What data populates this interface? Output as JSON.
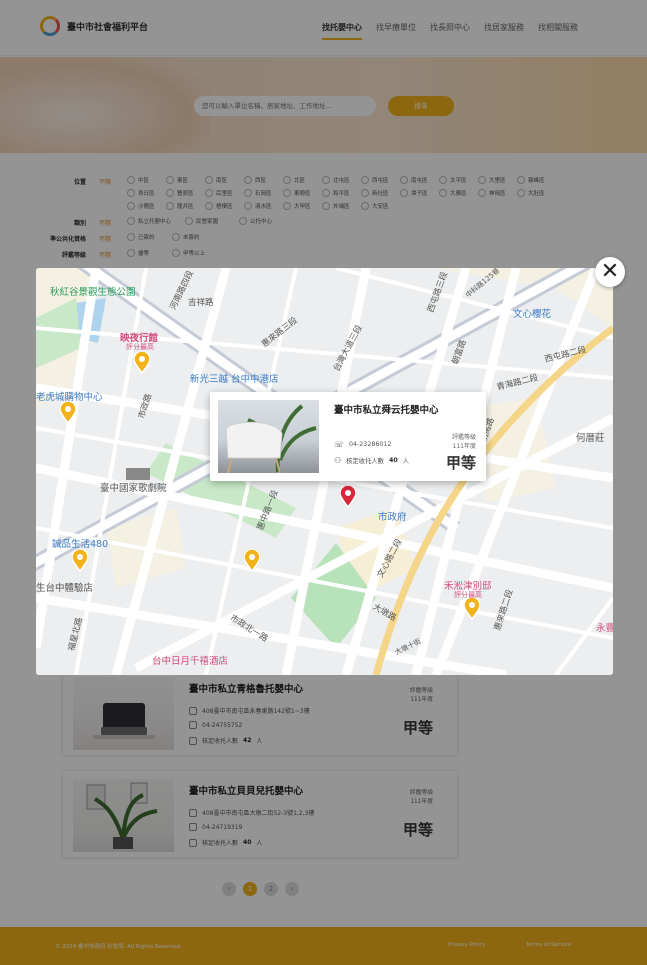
{
  "header": {
    "brand": "臺中市社會福利平台",
    "nav": [
      "找托嬰中心",
      "找早療單位",
      "找長照中心",
      "找居家服務",
      "找相關服務"
    ]
  },
  "search": {
    "placeholder": "您可以輸入單位名稱、居家地址、工作地址...",
    "button": "搜尋"
  },
  "filters": {
    "all_label": "不限",
    "location": {
      "label": "位置",
      "options": [
        "中區",
        "東區",
        "南區",
        "西區",
        "北區",
        "北屯區",
        "西屯區",
        "南屯區",
        "太平區",
        "大里區",
        "霧峰區",
        "烏日區",
        "豐原區",
        "后里區",
        "石岡區",
        "東勢區",
        "和平區",
        "新社區",
        "潭子區",
        "大雅區",
        "神岡區",
        "大肚區",
        "沙鹿區",
        "龍井區",
        "梧棲區",
        "清水區",
        "大甲區",
        "外埔區",
        "大安區"
      ]
    },
    "type": {
      "label": "類別",
      "options": [
        "私立托嬰中心",
        "民營家園",
        "公托中心"
      ]
    },
    "public": {
      "label": "準公共化資格",
      "options": [
        "已簽約",
        "未簽約"
      ]
    },
    "rating": {
      "label": "評鑑等級",
      "options": [
        "優等",
        "甲等以上"
      ]
    }
  },
  "map": {
    "labels": {
      "park": "秋紅谷景觀生態公園",
      "cinema": "映夜行館",
      "cinema_sub": "評分最高",
      "mall": "新光三越 台中中港店",
      "mall2": "老虎城購物中心",
      "opera": "臺中國家歌劇院",
      "eslite": "誠品生活480",
      "gym": "生台中體驗店",
      "hotel": "台中日月千禧酒店",
      "villa": "禾淞津別邸",
      "villa_sub": "評分最高",
      "cityhall": "市政府",
      "wenxin": "文心櫻花",
      "heping": "何厝莊",
      "yong": "永豐",
      "road_hui": "惠來路三段",
      "road_shizheng": "市政北一路",
      "road_wenxin": "文心路二段",
      "road_daya": "大墩路",
      "road_qinghai": "青海路二段",
      "road_xitun": "西屯路二段",
      "road_chaoma": "朝馬路",
      "road_chaofu": "朝富路",
      "road_jixiang": "吉祥路",
      "road_henan": "河南路四段",
      "road_xitun3": "西屯路三段",
      "road_taizhonggang": "台灣大道三段",
      "road_huizhong": "惠中路一段",
      "road_fuxing": "福星北路",
      "road_dadun10": "大墩十街",
      "road_huilai1": "惠來路二段",
      "road_shizheng2": "市政路",
      "road_125": "中科路125巷"
    },
    "popup": {
      "title": "臺中市私立舜云托嬰中心",
      "phone": "04-23286012",
      "capacity_label": "核定收托人數",
      "capacity": "40",
      "capacity_unit": "人",
      "rating_label": "評鑑等級",
      "rating_year": "111年度",
      "grade": "甲等"
    },
    "close_symbol": "✕"
  },
  "list": [
    {
      "title": "臺中市私立青格魯托嬰中心",
      "address": "408臺中市南屯區永春東路142號1~3樓",
      "phone": "04-24755752",
      "capacity_label": "核定收托人數",
      "capacity": "42",
      "capacity_unit": "人",
      "rating_label": "評鑑等級",
      "rating_year": "111年度",
      "grade": "甲等"
    },
    {
      "title": "臺中市私立貝貝兒托嬰中心",
      "address": "408臺中市南屯區大墩二街52-3號1,2,3樓",
      "phone": "04-24719319",
      "capacity_label": "核定收托人數",
      "capacity": "40",
      "capacity_unit": "人",
      "rating_label": "評鑑等級",
      "rating_year": "111年度",
      "grade": "甲等"
    }
  ],
  "pager": [
    "‹",
    "1",
    "2",
    "›"
  ],
  "footer": {
    "copyright": "© 2024 臺中市政府 社會局. All Rights Reserved.",
    "privacy": "Privacy Policy",
    "terms": "Terms of Service"
  },
  "colors": {
    "accent": "#f2b21a",
    "map_green": "#c9e7c6",
    "map_road": "#ffffff",
    "pin_yellow": "#f2b21a",
    "pin_red": "#d9263b"
  }
}
